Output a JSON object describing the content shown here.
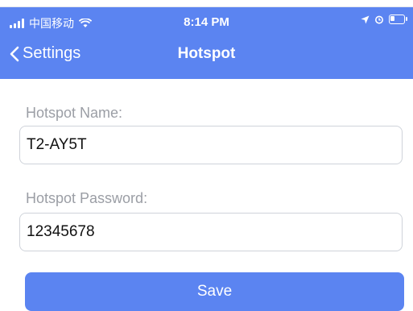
{
  "status_bar": {
    "carrier": "中国移动",
    "time": "8:14 PM"
  },
  "nav": {
    "back_label": "Settings",
    "title": "Hotspot"
  },
  "form": {
    "name_label": "Hotspot Name:",
    "name_value": "T2-AY5T",
    "password_label": "Hotspot Password:",
    "password_value": "12345678"
  },
  "actions": {
    "save_label": "Save"
  },
  "colors": {
    "accent": "#5b84f1",
    "label_gray": "#9b9ea5",
    "border": "#cfd3da"
  }
}
